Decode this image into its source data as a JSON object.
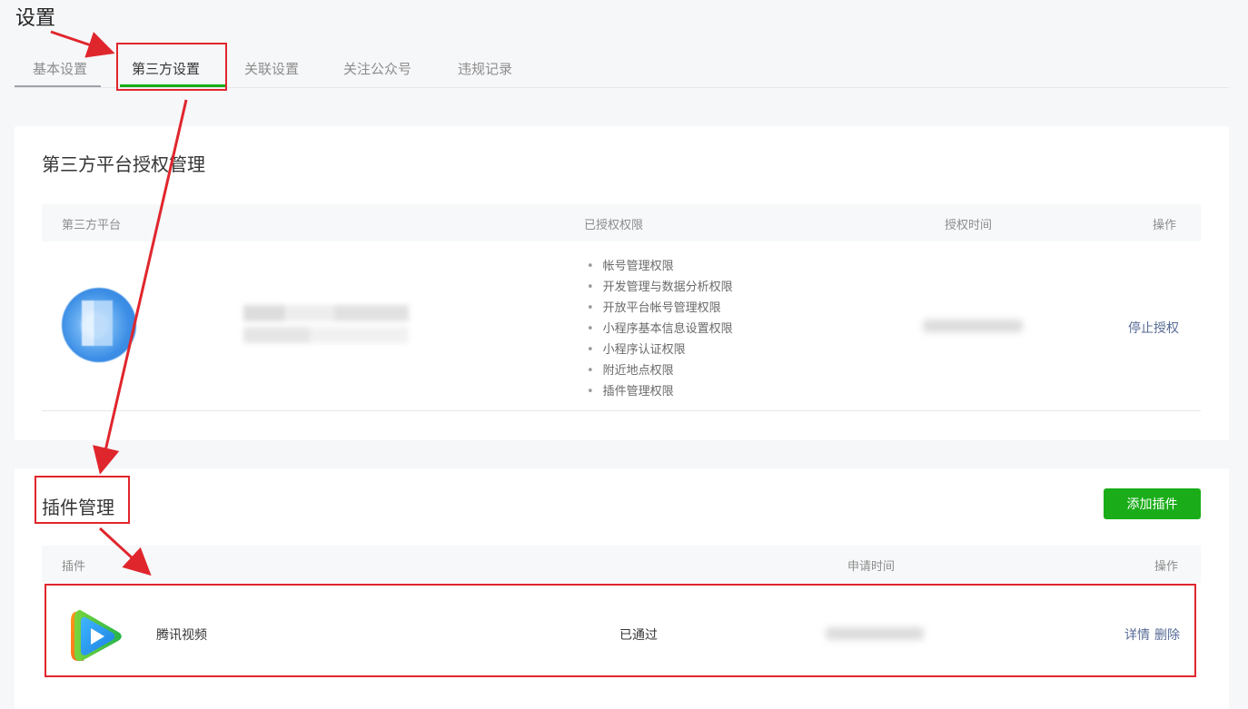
{
  "page": {
    "title": "设置"
  },
  "tabs": [
    {
      "label": "基本设置",
      "active": false
    },
    {
      "label": "第三方设置",
      "active": true
    },
    {
      "label": "关联设置",
      "active": false
    },
    {
      "label": "关注公众号",
      "active": false
    },
    {
      "label": "违规记录",
      "active": false
    }
  ],
  "third_party": {
    "title": "第三方平台授权管理",
    "columns": [
      "第三方平台",
      "已授权权限",
      "授权时间",
      "操作"
    ],
    "row": {
      "permissions": [
        "帐号管理权限",
        "开发管理与数据分析权限",
        "开放平台帐号管理权限",
        "小程序基本信息设置权限",
        "小程序认证权限",
        "附近地点权限",
        "插件管理权限"
      ],
      "action": "停止授权"
    }
  },
  "plugins": {
    "title": "插件管理",
    "add_button": "添加插件",
    "columns": [
      "插件",
      "申请时间",
      "操作"
    ],
    "row": {
      "name": "腾讯视频",
      "status": "已通过",
      "actions": [
        "详情",
        "删除"
      ]
    }
  },
  "colors": {
    "accent": "#1aad19",
    "link": "#576b95",
    "annotation": "#e0262d"
  }
}
